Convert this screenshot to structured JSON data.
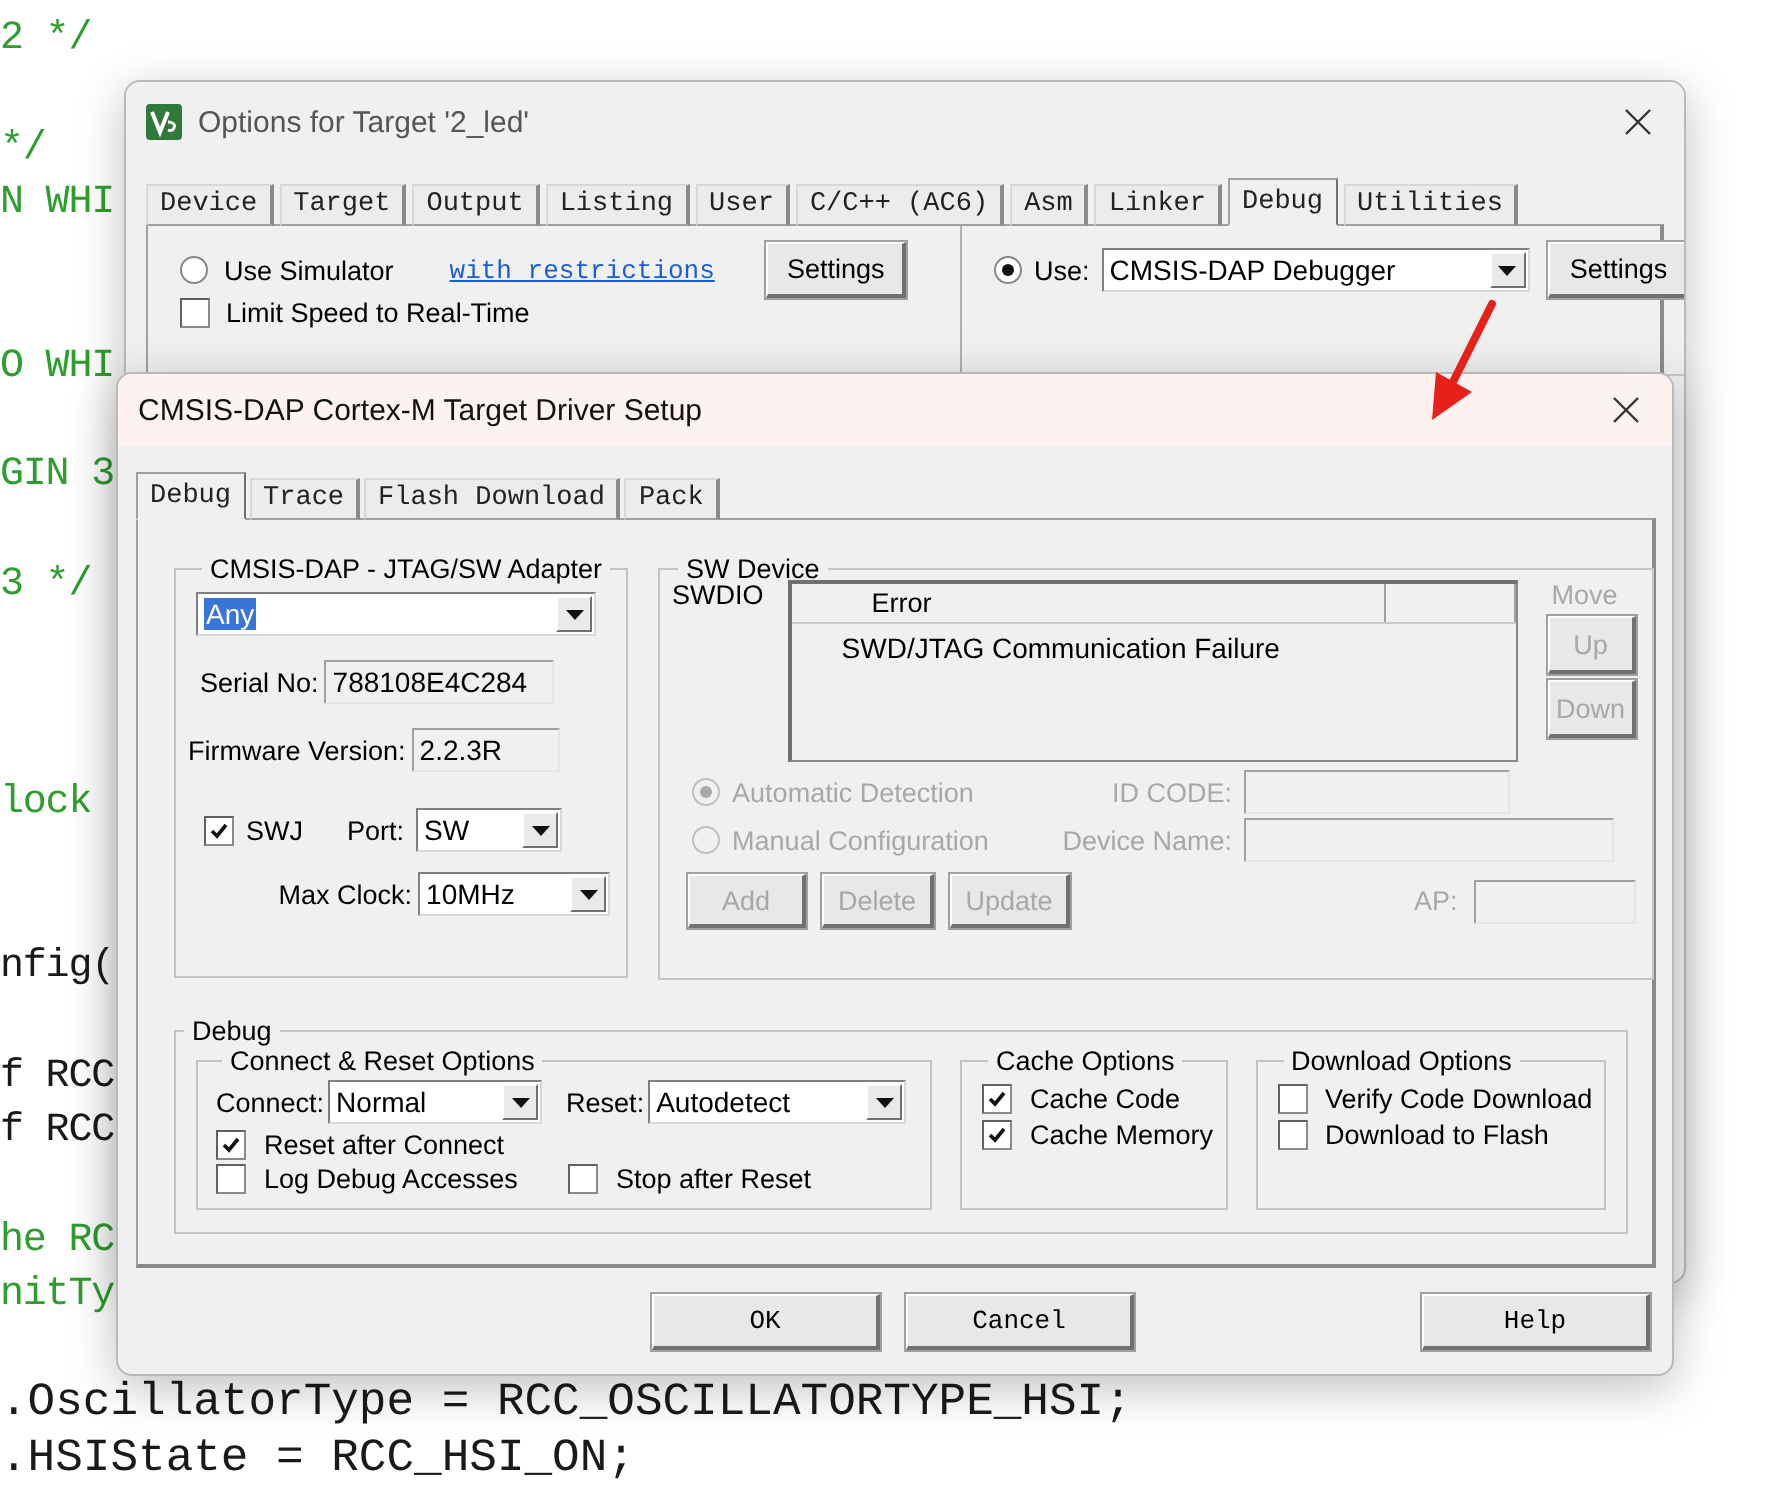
{
  "editor": {
    "lines": [
      {
        "kind": "comment",
        "text": "2 */"
      },
      {
        "kind": "blank"
      },
      {
        "kind": "comment",
        "text": "*/"
      },
      {
        "kind": "comment",
        "text": "N WHI"
      },
      {
        "kind": "blank"
      },
      {
        "kind": "blank"
      },
      {
        "kind": "comment",
        "text": "O WHI"
      },
      {
        "kind": "blank"
      },
      {
        "kind": "comment",
        "text": "GIN 3"
      },
      {
        "kind": "blank"
      },
      {
        "kind": "comment",
        "text": "3 */"
      },
      {
        "kind": "blank"
      },
      {
        "kind": "blank"
      },
      {
        "kind": "blank"
      },
      {
        "kind": "comment",
        "text": "lock"
      },
      {
        "kind": "blank"
      },
      {
        "kind": "blank"
      },
      {
        "kind": "code",
        "text": "nfig("
      },
      {
        "kind": "blank"
      },
      {
        "kind": "code",
        "text": "f RCC"
      },
      {
        "kind": "code",
        "text": "f RCC"
      },
      {
        "kind": "blank"
      },
      {
        "kind": "comment",
        "text": "he RC"
      },
      {
        "kind": "comment",
        "text": "nitTy"
      },
      {
        "kind": "blank"
      },
      {
        "kind": "code",
        "text": ".OscillatorType = RCC_OSCILLATORTYPE_HSI;"
      },
      {
        "kind": "code",
        "text": ".HSIState = RCC_HSI_ON;"
      }
    ]
  },
  "options_window": {
    "title": "Options for Target '2_led'",
    "tabs": [
      {
        "label": "Device",
        "selected": false
      },
      {
        "label": "Target",
        "selected": false
      },
      {
        "label": "Output",
        "selected": false
      },
      {
        "label": "Listing",
        "selected": false
      },
      {
        "label": "User",
        "selected": false
      },
      {
        "label": "C/C++ (AC6)",
        "selected": false
      },
      {
        "label": "Asm",
        "selected": false
      },
      {
        "label": "Linker",
        "selected": false
      },
      {
        "label": "Debug",
        "selected": true
      },
      {
        "label": "Utilities",
        "selected": false
      }
    ],
    "simulator": {
      "label": "Use Simulator",
      "selected": false
    },
    "restrictions_link": "with restrictions",
    "simulator_settings": "Settings",
    "limit_speed": {
      "label": "Limit Speed to Real-Time",
      "checked": false
    },
    "use_debugger": {
      "label": "Use:",
      "selected": true
    },
    "debugger": "CMSIS-DAP Debugger",
    "debugger_settings": "Settings"
  },
  "dialog": {
    "title": "CMSIS-DAP Cortex-M Target Driver Setup",
    "tabs": [
      {
        "label": "Debug",
        "selected": true
      },
      {
        "label": "Trace",
        "selected": false
      },
      {
        "label": "Flash Download",
        "selected": false
      },
      {
        "label": "Pack",
        "selected": false
      }
    ],
    "adapter": {
      "title": "CMSIS-DAP - JTAG/SW Adapter",
      "device": {
        "value": "Any",
        "highlighted": true
      },
      "serial_label": "Serial No:",
      "serial": "788108E4C284",
      "firmware_label": "Firmware Version:",
      "firmware": "2.2.3R",
      "swj": {
        "label": "SWJ",
        "checked": true
      },
      "port_label": "Port:",
      "port": "SW",
      "max_clock_label": "Max Clock:",
      "max_clock": "10MHz"
    },
    "sw_device": {
      "title": "SW Device",
      "disabled": true,
      "row_label": "SWDIO",
      "columns": [
        "Error"
      ],
      "rows": [
        "SWD/JTAG Communication Failure"
      ],
      "move_label": "Move",
      "move_buttons": [
        "Up",
        "Down"
      ],
      "detection": [
        {
          "label": "Automatic Detection",
          "selected": true
        },
        {
          "label": "Manual Configuration",
          "selected": false
        }
      ],
      "id_code_label": "ID CODE:",
      "device_name_label": "Device Name:",
      "ap_label": "AP:",
      "buttons": [
        "Add",
        "Delete",
        "Update"
      ]
    },
    "debug": {
      "title": "Debug",
      "connect_reset": {
        "title": "Connect & Reset Options",
        "connect_label": "Connect:",
        "connect": "Normal",
        "reset_label": "Reset:",
        "reset": "Autodetect",
        "options": [
          {
            "label": "Reset after Connect",
            "checked": true
          },
          {
            "label": "Log Debug Accesses",
            "checked": false
          },
          {
            "label": "Stop after Reset",
            "checked": false
          }
        ]
      },
      "cache": {
        "title": "Cache Options",
        "options": [
          {
            "label": "Cache Code",
            "checked": true
          },
          {
            "label": "Cache Memory",
            "checked": true
          }
        ]
      },
      "download": {
        "title": "Download Options",
        "options": [
          {
            "label": "Verify Code Download",
            "checked": false
          },
          {
            "label": "Download to Flash",
            "checked": false
          }
        ]
      }
    },
    "buttons": [
      "OK",
      "Cancel",
      "Help"
    ]
  }
}
